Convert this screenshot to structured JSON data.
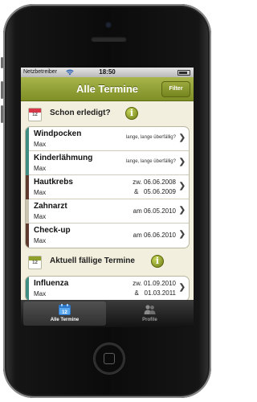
{
  "status_bar": {
    "carrier": "Netzbetreiber",
    "time": "18:50",
    "battery_level": 0.85
  },
  "nav": {
    "title": "Alle Termine",
    "filter_label": "Filter"
  },
  "sections": [
    {
      "title": "Schon erledigt?",
      "icon": "calendar-red-icon",
      "icon_day": "12",
      "rows": [
        {
          "name": "Windpocken",
          "person": "Max",
          "note": "lange, lange überfällig?",
          "color": "#3f8c80"
        },
        {
          "name": "Kinderlähmung",
          "person": "Max",
          "note": "lange, lange überfällig?",
          "color": "#3f8c80"
        },
        {
          "name": "Hautkrebs",
          "person": "Max",
          "date1": "zw. 06.06.2008",
          "date2": "&   05.06.2009",
          "color": "#5e3b2c"
        },
        {
          "name": "Zahnarzt",
          "person": "Max",
          "date": "am 06.05.2010",
          "color": "#c8c2ae"
        },
        {
          "name": "Check-up",
          "person": "Max",
          "date": "am 06.06.2010",
          "color": "#5e3b2c"
        }
      ]
    },
    {
      "title": "Aktuell fällige Termine",
      "icon": "calendar-green-icon",
      "icon_day": "12",
      "rows": [
        {
          "name": "Influenza",
          "person": "Max",
          "date1": "zw. 01.09.2010",
          "date2": "&   01.03.2011",
          "color": "#3f8c80"
        }
      ]
    }
  ],
  "tabs": [
    {
      "label": "Alle Termine",
      "icon": "calendar-tab-icon",
      "active": true
    },
    {
      "label": "Profile",
      "icon": "people-tab-icon",
      "active": false
    }
  ],
  "colors": {
    "nav_green": "#8c9b30",
    "background": "#f2efde",
    "info_green": "#6c7c13",
    "tab_active_blue": "#4a9be0"
  }
}
